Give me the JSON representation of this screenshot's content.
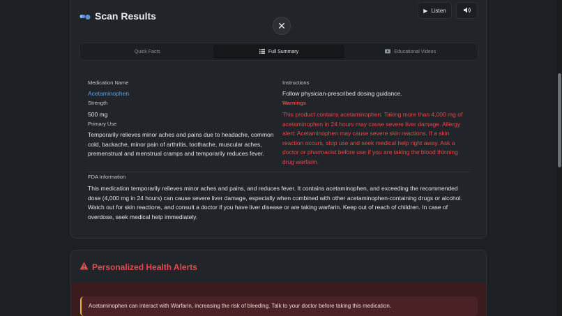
{
  "header": {
    "title": "Scan Results",
    "listen_label": "Listen"
  },
  "tabs": [
    {
      "label": "Quick Facts",
      "icon": "",
      "active": false
    },
    {
      "label": "Full Summary",
      "icon": "list-icon",
      "active": true
    },
    {
      "label": "Educational Videos",
      "icon": "video-icon",
      "active": false
    }
  ],
  "summary": {
    "medication_name_label": "Medication Name",
    "medication_name": "Acetaminophen",
    "strength_label": "Strength",
    "strength": "500 mg",
    "primary_use_label": "Primary Use",
    "primary_use": "Temporarily relieves minor aches and pains due to headache, common cold, backache, minor pain of arthritis, toothache, muscular aches, premenstrual and menstrual cramps and temporarily reduces fever.",
    "instructions_label": "Instructions",
    "instructions": "Follow physician-prescribed dosing guidance.",
    "warnings_label": "Warnings",
    "warnings": "This product contains acetaminophen. Taking more than 4,000 mg of acetaminophen in 24 hours may cause severe liver damage. Allergy alert: Acetaminophen may cause severe skin reactions. If a skin reaction occurs, stop use and seek medical help right away. Ask a doctor or pharmacist before use if you are taking the blood thinning drug warfarin.",
    "fda_label": "FDA Information",
    "fda_info": "This medication temporarily relieves minor aches and pains, and reduces fever. It contains acetaminophen, and exceeding the recommended dose (4,000 mg in 24 hours) can cause severe liver damage, especially when combined with other acetaminophen-containing drugs or alcohol. Watch out for skin reactions, and consult a doctor if you have liver disease or are taking warfarin. Keep out of reach of children. In case of overdose, seek medical help immediately."
  },
  "alerts": {
    "title": "Personalized Health Alerts",
    "items": [
      {
        "text": "Acetaminophen can interact with Warfarin, increasing the risk of bleeding. Talk to your doctor before taking this medication."
      }
    ]
  },
  "colors": {
    "accent_red": "#e5484d",
    "link_blue": "#5aa1e6",
    "alert_border": "#f0b429"
  }
}
